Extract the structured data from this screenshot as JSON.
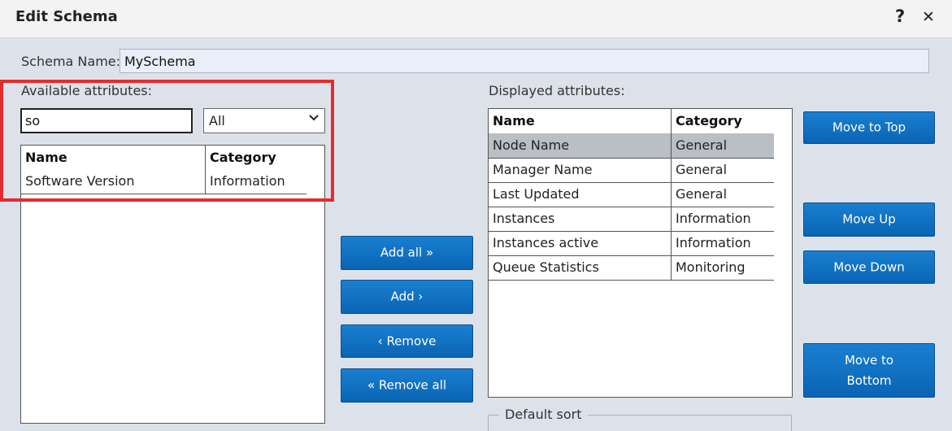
{
  "dialog": {
    "title": "Edit Schema",
    "help_glyph": "?",
    "close_glyph": "✕"
  },
  "schema_name": {
    "label": "Schema Name:",
    "value": "MySchema"
  },
  "available": {
    "label": "Available attributes:",
    "search_value": "so",
    "filter_value": "All",
    "columns": [
      "Name",
      "Category"
    ],
    "rows": [
      {
        "name": "Software Version",
        "category": "Information"
      }
    ]
  },
  "buttons": {
    "add_all": "Add all »",
    "add": "Add ›",
    "remove": "‹ Remove",
    "remove_all": "« Remove all",
    "move_top": "Move to Top",
    "move_up": "Move Up",
    "move_down": "Move Down",
    "move_bottom": "Move to Bottom"
  },
  "displayed": {
    "label": "Displayed attributes:",
    "columns": [
      "Name",
      "Category"
    ],
    "rows": [
      {
        "name": "Node Name",
        "category": "General"
      },
      {
        "name": "Manager Name",
        "category": "General"
      },
      {
        "name": "Last Updated",
        "category": "General"
      },
      {
        "name": "Instances",
        "category": "Information"
      },
      {
        "name": "Instances active",
        "category": "Information"
      },
      {
        "name": "Queue Statistics",
        "category": "Monitoring"
      }
    ],
    "selected_index": 0
  },
  "default_sort": {
    "legend": "Default sort"
  },
  "colors": {
    "button_blue": "#0a64b4",
    "highlight_red": "#e32c2c",
    "selected_row": "#b9bfc5"
  }
}
